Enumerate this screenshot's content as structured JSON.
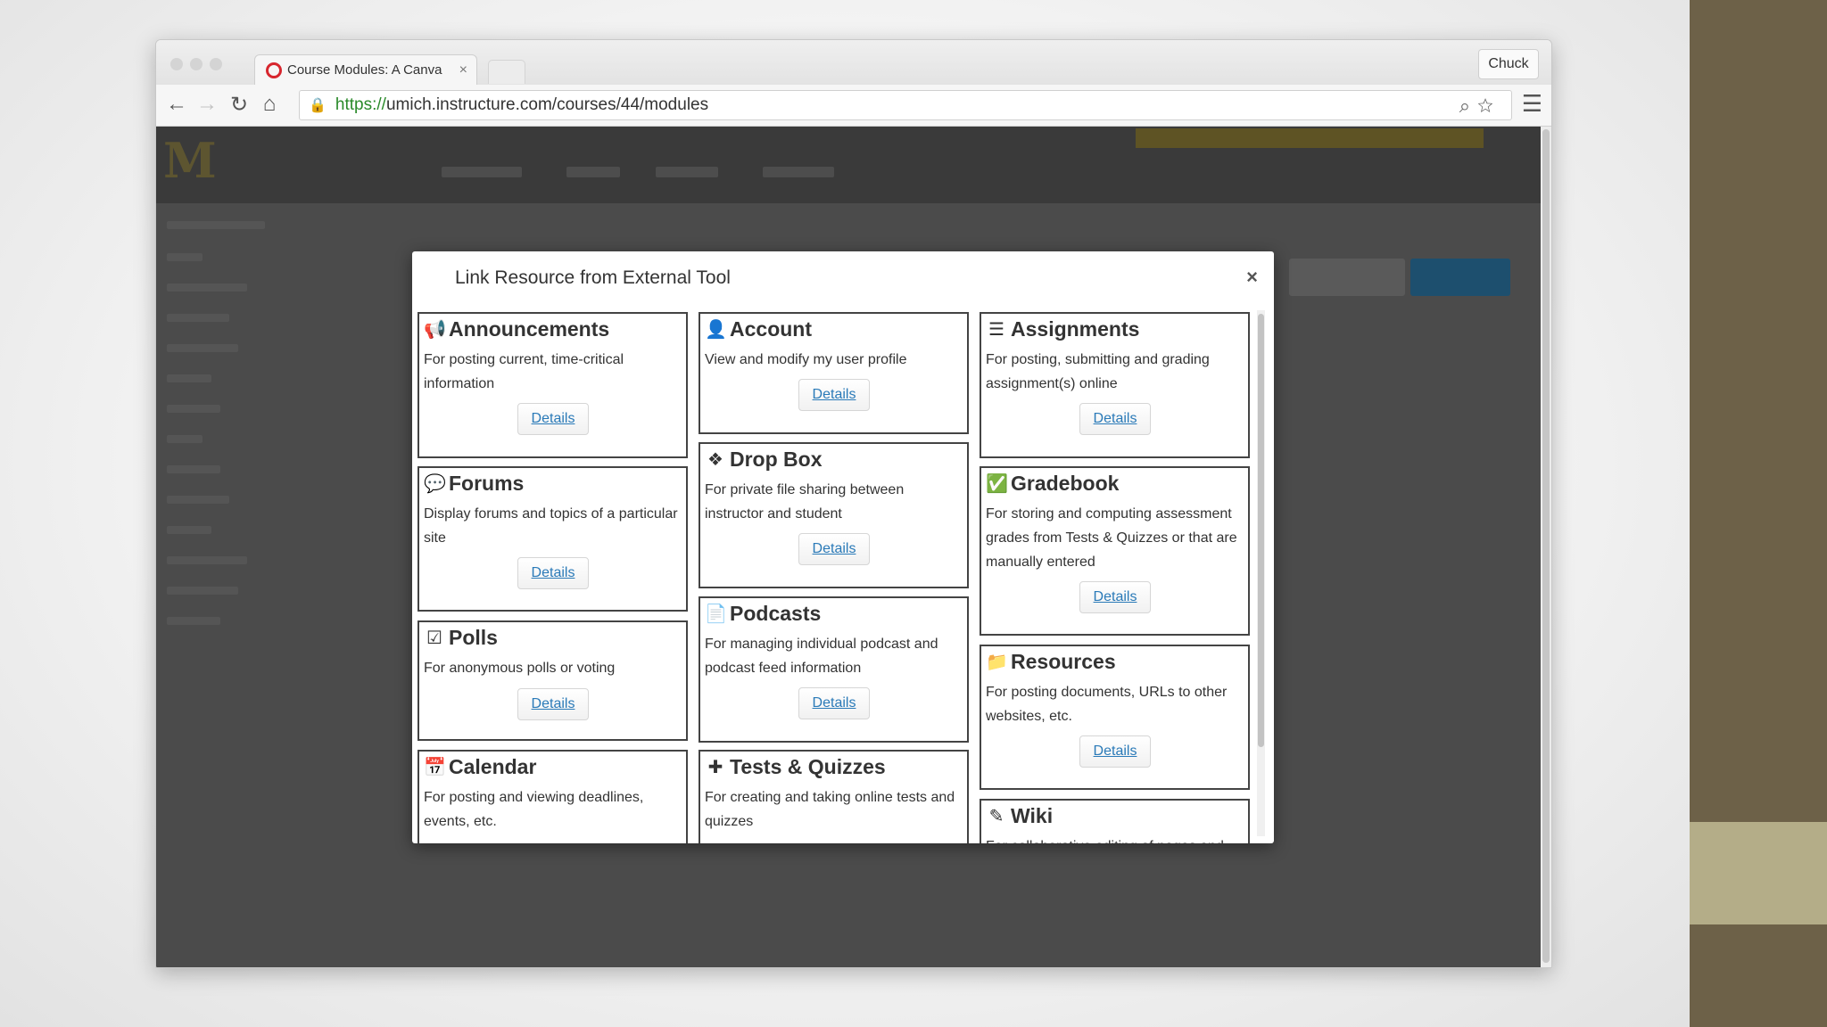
{
  "browser": {
    "tab_title": "Course Modules: A Canva",
    "profile_name": "Chuck",
    "url_scheme": "https://",
    "url_rest": "umich.instructure.com/courses/44/modules"
  },
  "modal": {
    "title": "Link Resource from External Tool",
    "close_glyph": "×",
    "details_label": "Details",
    "tools": [
      {
        "name": "Announcements",
        "icon": "megaphone-icon",
        "glyph": "📢",
        "description": "For posting current, time-critical information"
      },
      {
        "name": "Forums",
        "icon": "comments-icon",
        "glyph": "💬",
        "description": "Display forums and topics of a particular site"
      },
      {
        "name": "Polls",
        "icon": "checkbox-icon",
        "glyph": "☑",
        "description": "For anonymous polls or voting"
      },
      {
        "name": "Calendar",
        "icon": "calendar-icon",
        "glyph": "📅",
        "description": "For posting and viewing deadlines, events, etc."
      },
      {
        "name": "Account",
        "icon": "user-icon",
        "glyph": "👤",
        "description": "View and modify my user profile"
      },
      {
        "name": "Drop Box",
        "icon": "dropbox-icon",
        "glyph": "❖",
        "description": "For private file sharing between instructor and student"
      },
      {
        "name": "Podcasts",
        "icon": "podcast-file-icon",
        "glyph": "📄",
        "description": "For managing individual podcast and podcast feed information"
      },
      {
        "name": "Tests & Quizzes",
        "icon": "puzzle-icon",
        "glyph": "✚",
        "description": "For creating and taking online tests and quizzes"
      },
      {
        "name": "Assignments",
        "icon": "list-icon",
        "glyph": "☰",
        "description": "For posting, submitting and grading assignment(s) online"
      },
      {
        "name": "Gradebook",
        "icon": "check-square-icon",
        "glyph": "✅",
        "description": "For storing and computing assessment grades from Tests & Quizzes or that are manually entered"
      },
      {
        "name": "Resources",
        "icon": "folder-icon",
        "glyph": "📁",
        "description": "For posting documents, URLs to other websites, etc."
      },
      {
        "name": "Wiki",
        "icon": "edit-icon",
        "glyph": "✎",
        "description": "For collaborative editing of pages and"
      }
    ]
  }
}
